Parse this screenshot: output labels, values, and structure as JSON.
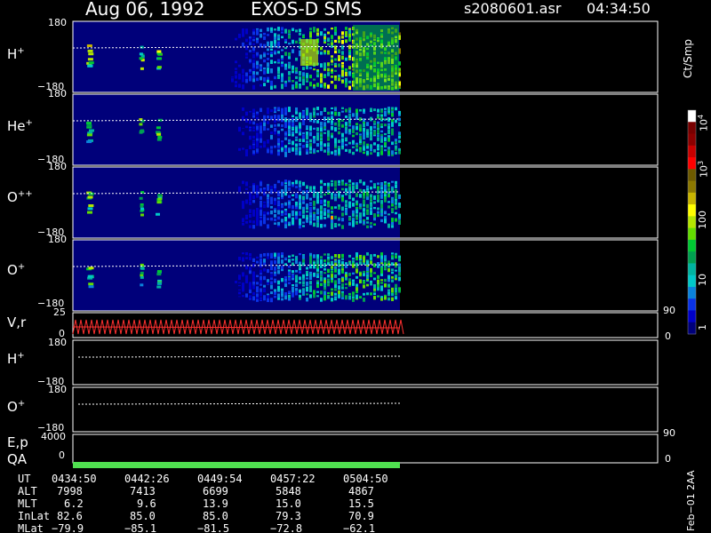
{
  "header": {
    "date": "Aug 06, 1992",
    "instrument": "EXOS-D SMS",
    "filename": "s2080601.asr",
    "time": "04:34:50"
  },
  "colorbar": {
    "unit": "Ct/Smp",
    "ticks": [
      {
        "label": "1",
        "value": 1
      },
      {
        "label": "10",
        "value": 10
      },
      {
        "label": "100",
        "value": 100
      },
      {
        "label": "10",
        "exp": "3",
        "value": 1000
      },
      {
        "label": "10",
        "exp": "4",
        "value": 10000
      }
    ],
    "colors": [
      "#00007a",
      "#0000c8",
      "#0a32e6",
      "#0a82dc",
      "#00c8c8",
      "#00b4a0",
      "#00a050",
      "#00c832",
      "#64dc00",
      "#b4e600",
      "#ffff00",
      "#c8b400",
      "#8c7800",
      "#6e5a00",
      "#ff0000",
      "#c80000",
      "#8c0000",
      "#780000",
      "#ffffff"
    ]
  },
  "panels": [
    {
      "id": "h-plus",
      "species": "H",
      "charge": "+",
      "y_top": "180",
      "y_bottom": "−180"
    },
    {
      "id": "he-plus",
      "species": "He",
      "charge": "+",
      "y_top": "180",
      "y_bottom": "−180"
    },
    {
      "id": "o-plus-plus",
      "species": "O",
      "charge": "++",
      "y_top": "180",
      "y_bottom": "−180"
    },
    {
      "id": "o-plus",
      "species": "O",
      "charge": "+",
      "y_top": "180",
      "y_bottom": "−180"
    }
  ],
  "vr_panel": {
    "label": "V,r",
    "left_top": "25",
    "left_bottom": "0",
    "right_top": "90",
    "right_bottom": "0"
  },
  "lower_panels": [
    {
      "id": "h-plus-2",
      "species": "H",
      "charge": "+",
      "y_top": "180",
      "y_bottom": "−180"
    },
    {
      "id": "o-plus-2",
      "species": "O",
      "charge": "+",
      "y_top": "180",
      "y_bottom": "−180"
    }
  ],
  "ep_panel": {
    "label_top": "E,p",
    "label_bottom": "QA",
    "left_top": "4000",
    "left_bottom": "0",
    "right_top": "90",
    "right_bottom": "0"
  },
  "annotations": {
    "rows": [
      "UT",
      "ALT",
      "MLT",
      "InLat",
      "MLat"
    ],
    "columns": [
      [
        "0434:50",
        "7998",
        "6.2",
        "82.6",
        "−79.9"
      ],
      [
        "0442:26",
        "7413",
        "9.6",
        "85.0",
        "−85.1"
      ],
      [
        "0449:54",
        "6699",
        "13.9",
        "85.0",
        "−81.5"
      ],
      [
        "0457:22",
        "5848",
        "15.0",
        "79.3",
        "−72.8"
      ],
      [
        "0504:50",
        "4867",
        "15.5",
        "70.9",
        "−62.1"
      ]
    ]
  },
  "footer_label": "Feb−01 2AA"
}
